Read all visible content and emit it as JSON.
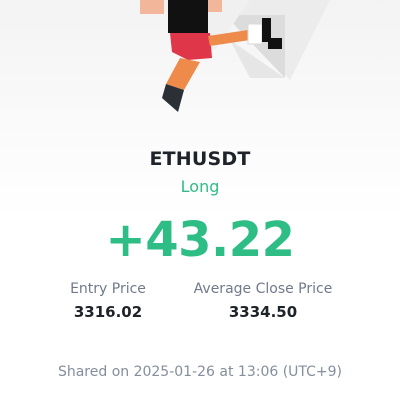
{
  "position": {
    "symbol": "ETHUSDT",
    "side": "Long",
    "pnl": "+43.22"
  },
  "stats": {
    "entry_label": "Entry Price",
    "entry_value": "3316.02",
    "close_label": "Average Close Price",
    "close_value": "3334.50"
  },
  "footer": {
    "shared": "Shared on 2025-01-26 at 13:06 (UTC+9)"
  },
  "colors": {
    "profit": "#2ebd85",
    "text_primary": "#1e2329",
    "text_secondary": "#707a8a",
    "illustration_red": "#e0364a",
    "illustration_orange": "#ee8a4a"
  },
  "illustration": {
    "name": "jumping-character-illustration"
  }
}
